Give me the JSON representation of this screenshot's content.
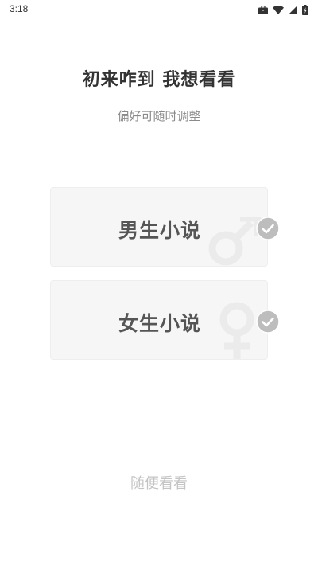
{
  "status_bar": {
    "time": "3:18",
    "icons": [
      "briefcase-icon",
      "wifi-icon",
      "signal-icon",
      "battery-charging-icon"
    ]
  },
  "header": {
    "title": "初来咋到 我想看看",
    "subtitle": "偏好可随时调整"
  },
  "options": [
    {
      "label": "男生小说",
      "symbol": "male-symbol",
      "checked": true
    },
    {
      "label": "女生小说",
      "symbol": "female-symbol",
      "checked": true
    }
  ],
  "footer": {
    "casual_label": "随便看看"
  },
  "colors": {
    "card_background": "#f6f6f6",
    "check_circle": "#bdbdbd",
    "title_text": "#333333",
    "subtitle_text": "#8a8a8a",
    "link_text": "#c4c4c4"
  }
}
